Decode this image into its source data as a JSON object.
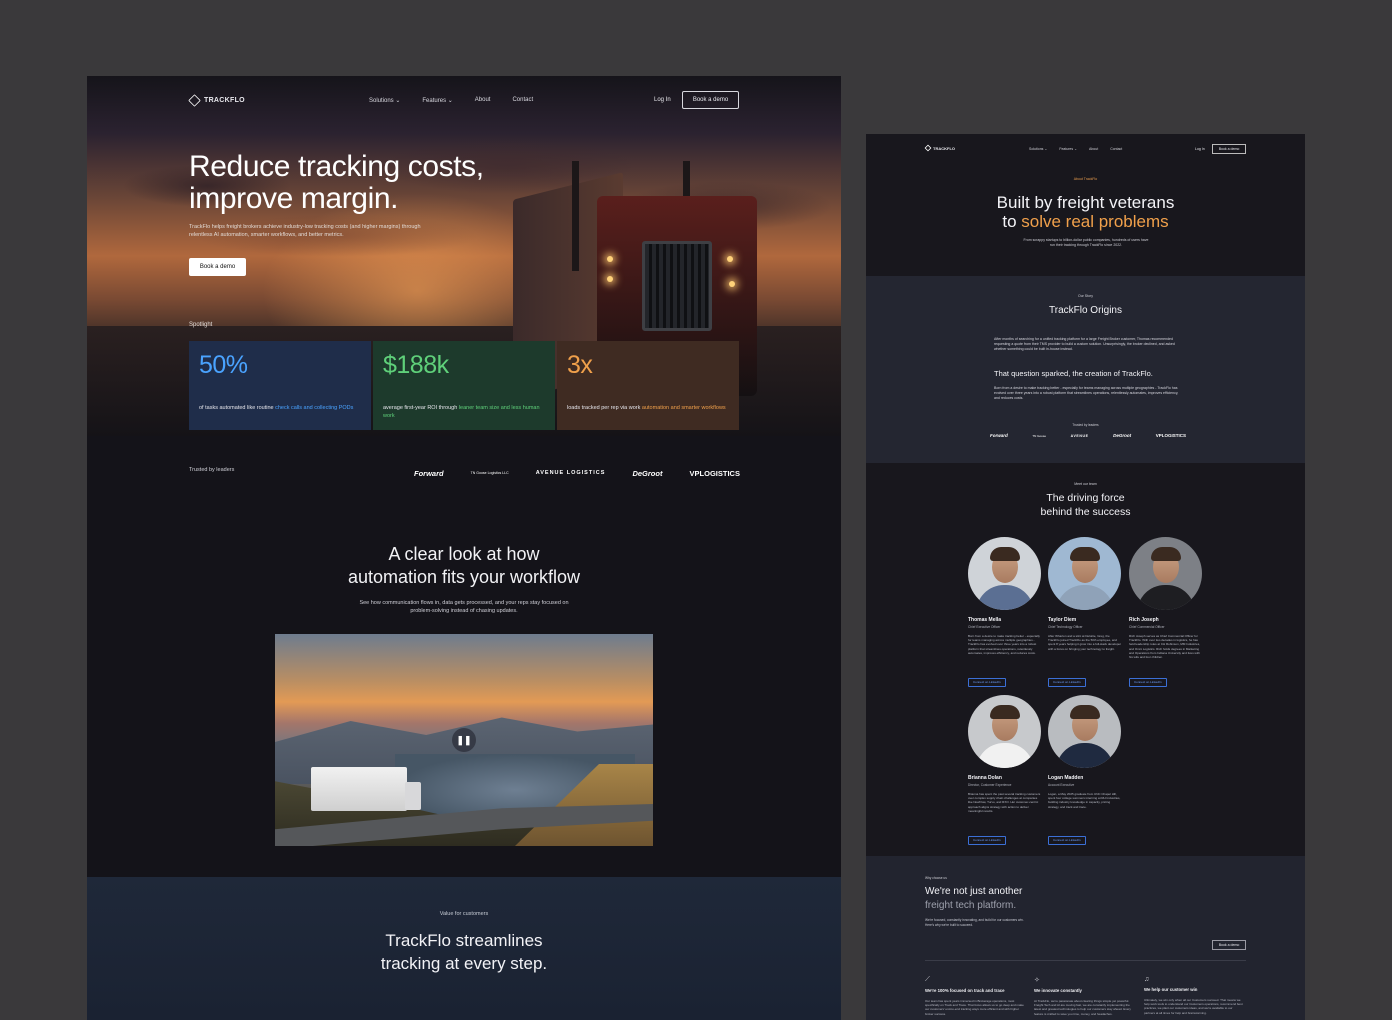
{
  "left": {
    "nav": {
      "brand": "TRACKFLO",
      "links": [
        "Solutions ⌄",
        "Features ⌄",
        "About",
        "Contact"
      ],
      "login": "Log In",
      "cta": "Book a demo"
    },
    "hero": {
      "title": "Reduce tracking costs, improve margin.",
      "subtitle": "TrackFlo helps freight brokers achieve industry-low tracking costs (and higher margins) through relentless AI automation, smarter workflows, and better metrics.",
      "cta": "Book a demo",
      "spotlight_label": "Spotlight"
    },
    "stats": [
      {
        "value": "50%",
        "text": "of tasks automated like routine ",
        "highlight": "check calls and collecting PODs",
        "accent": "#4aa3ff",
        "bg": "#1f2d4a"
      },
      {
        "value": "$188k",
        "text": "average first-year ROI through ",
        "highlight": "leaner team size and less human work",
        "accent": "#5fd07a",
        "bg": "#1d3a2c"
      },
      {
        "value": "3x",
        "text": "loads tracked per rep via work ",
        "highlight": "automation and smarter workflows",
        "accent": "#f0a04b",
        "bg": "#3f2b22"
      }
    ],
    "trusted_label": "Trusted by leaders",
    "partners": [
      "Forward",
      "TN Goose Logistics LLC",
      "AVENUE LOGISTICS",
      "DeGroot",
      "VPLOGISTICS"
    ],
    "workflow": {
      "title_line1": "A clear look at how",
      "title_line2": "automation fits your workflow",
      "subtitle": "See how communication flows in, data gets processed, and your reps stay focused on problem-solving instead of chasing updates.",
      "pause_icon": "pause-icon"
    },
    "value": {
      "kicker": "Value for customers",
      "title_line1": "TrackFlo streamlines",
      "title_line2": "tracking at every step."
    }
  },
  "right": {
    "nav": {
      "brand": "TRACKFLO",
      "links": [
        "Solutions ⌄",
        "Features ⌄",
        "About",
        "Contact"
      ],
      "login": "Log In",
      "cta": "Book a demo"
    },
    "hero": {
      "kicker": "About TrackFlo",
      "title_line1": "Built by freight veterans",
      "title_line2_pre": "to ",
      "title_line2_accent": "solve real problems",
      "subtitle": "From scrappy startups to billion-dollar public companies, hundreds of users have run their tracking through TrackFlo since 2022."
    },
    "story": {
      "kicker": "Our Story",
      "title": "TrackFlo Origins",
      "p1": "After months of searching for a unified tracking platform for a large Freight Broker customer, Thomas recommended requesting a quote from their TMS provider to build a custom solution. Unsurprisingly, the broker declined, and asked whether something could be built in-house instead.",
      "quote": "That question sparked, the creation of TrackFlo.",
      "p2": "Born from a desire to make tracking better - especially for teams managing across multiple geographies - TrackFlo has evolved over three years into a robust platform that streamlines operations, relentlessly automates, improves efficiency, and reduces costs.",
      "trusted": "Trusted by leaders",
      "partners": [
        "Forward",
        "TN Goose",
        "AVENUE",
        "DeGroot",
        "VPLOGISTICS"
      ]
    },
    "team": {
      "kicker": "Meet our team",
      "title_line1": "The driving force",
      "title_line2": "behind the success",
      "link_label": "Connect on LinkedIn",
      "members": [
        {
          "name": "Thomas Mella",
          "role": "Chief Executive Officer",
          "bio": "Born from a desire to make tracking better - especially for teams managing across multiple geographies - TrackFlo has evolved over three years into a robust platform that streamlines operations, relentlessly automates, improves efficiency, and reduces costs.",
          "bg": "#cfd3d8",
          "shirt": "#5b6f93"
        },
        {
          "name": "Taylor Diem",
          "role": "Chief Technology Officer",
          "bio": "After Wharton and a stint at Deloitte, Greg, the TrackFlo joined TrackFlo as the 50th employee, and spent 8 years helping it grow into a full-stack developer with a focus on bringing your technology to freight.",
          "bg": "#9fb8d2",
          "shirt": "#8fa2b8"
        },
        {
          "name": "Rich Joseph",
          "role": "Chief Commercial Officer",
          "bio": "Rich Joseph serves as Chief Commercial Officer for TrackFlo. With over two decades in logistics, he has held leadership roles at CH Robinson, MM Industries, and Omni Logistics. Rich holds degrees in Marketing and Operations from Indiana University and lives with his wife and four children.",
          "bg": "#7d8086",
          "shirt": "#1e1e22"
        },
        {
          "name": "Brianna Dolan",
          "role": "Director, Customer Experience",
          "bio": "Brianna has spent the past several tracking customers over complex supply chain challenges at companies like NowFlow, Turvo, and RXO. Her customer-centric approach aligns strategy with action to deliver meaningful results.",
          "bg": "#c7c9cc",
          "shirt": "#f1f1f1"
        },
        {
          "name": "Logan Madden",
          "role": "Account Executive",
          "bio": "Logan, a May 2025 graduate from UNC Chapel Hill, spent four college summers interning at RH Industries, building industry knowledge in capacity, pricing strategy, and track and trace.",
          "bg": "#b9bcc0",
          "shirt": "#1f2a40"
        }
      ]
    },
    "why": {
      "kicker": "Why choose us",
      "title_line1": "We're not just another",
      "title_line2": "freight tech platform.",
      "subtitle": "We're focused, constantly innovating, and build for our customers win. Here's why we're built to succeed.",
      "cta": "Book a demo",
      "features": [
        {
          "icon": "chart-icon",
          "title": "We're 100% focused on track and trace",
          "body": "Our team has spent years immersed in Brokerage operations, most specifically on Track and Trace. That focus allows us to go deep and make our customers' end-to-end tracking ways more efficient and with higher broker success."
        },
        {
          "icon": "sparkle-icon",
          "title": "We innovate constantly",
          "body": "At TrackFlo, we're passionate about clearing things simple yet powerful. Freight Tech and AI are moving fast, we are constantly implementing the latest and greatest technologies to help our customers stay ahead. Every feature is crafted to save you time, money, and headaches."
        },
        {
          "icon": "bell-icon",
          "title": "We help our customer win",
          "body": "Ultimately, we win only when all our Customers succeed. That means we help work tools to understand our Customers operations, recommend best practices, we plant our customers ideas, and we're available to our partners at all times for help and brainstorming."
        }
      ]
    }
  }
}
